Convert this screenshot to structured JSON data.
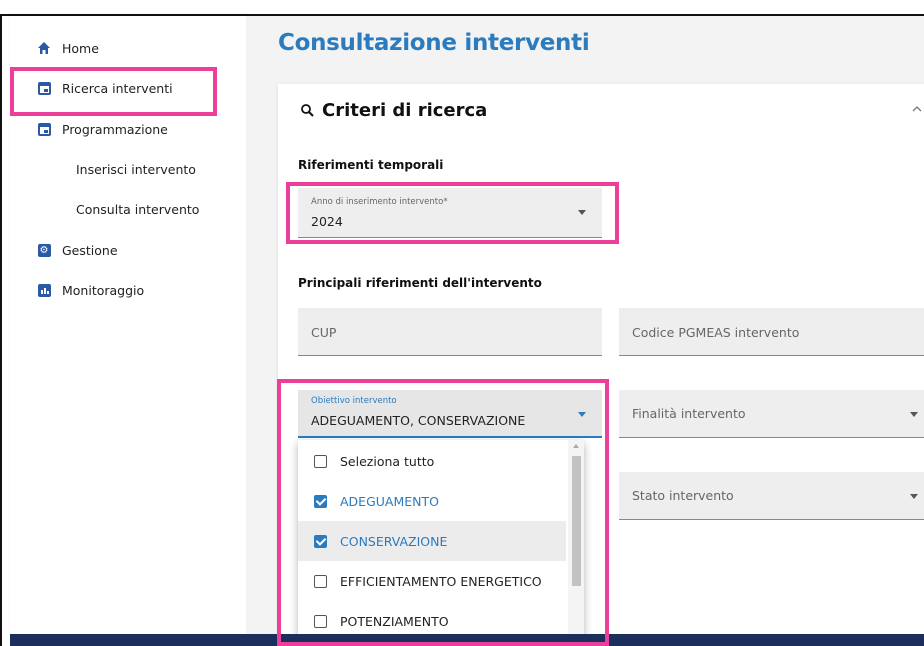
{
  "sidebar": {
    "items": [
      {
        "label": "Home",
        "icon": "home-icon"
      },
      {
        "label": "Ricerca interventi",
        "icon": "calendar-icon"
      },
      {
        "label": "Programmazione",
        "icon": "calendar-icon"
      },
      {
        "label": "Inserisci intervento"
      },
      {
        "label": "Consulta intervento"
      },
      {
        "label": "Gestione",
        "icon": "gear-icon"
      },
      {
        "label": "Monitoraggio",
        "icon": "chart-icon"
      }
    ]
  },
  "page": {
    "title": "Consultazione interventi"
  },
  "card": {
    "title": "Criteri di ricerca",
    "search_icon": "search-icon",
    "collapse_icon": "chevron-up-icon"
  },
  "sections": {
    "temporal": "Riferimenti temporali",
    "principal": "Principali riferimenti dell'intervento"
  },
  "fields": {
    "anno": {
      "label": "Anno di inserimento intervento*",
      "value": "2024"
    },
    "cup": {
      "placeholder": "CUP"
    },
    "codice": {
      "placeholder": "Codice PGMEAS intervento"
    },
    "obiettivo": {
      "label": "Obiettivo intervento",
      "value": "ADEGUAMENTO, CONSERVAZIONE"
    },
    "finalita": {
      "placeholder": "Finalità intervento"
    },
    "stato": {
      "placeholder": "Stato intervento"
    }
  },
  "dropdown": {
    "options": [
      {
        "label": "Seleziona tutto",
        "checked": false
      },
      {
        "label": "ADEGUAMENTO",
        "checked": true
      },
      {
        "label": "CONSERVAZIONE",
        "checked": true
      },
      {
        "label": "EFFICIENTAMENTO ENERGETICO",
        "checked": false
      },
      {
        "label": "POTENZIAMENTO",
        "checked": false
      }
    ]
  },
  "colors": {
    "accent": "#2b7bbf",
    "highlight": "#ec3f9a",
    "nav_icon": "#2a5aa5",
    "footer": "#1c2e5c"
  }
}
